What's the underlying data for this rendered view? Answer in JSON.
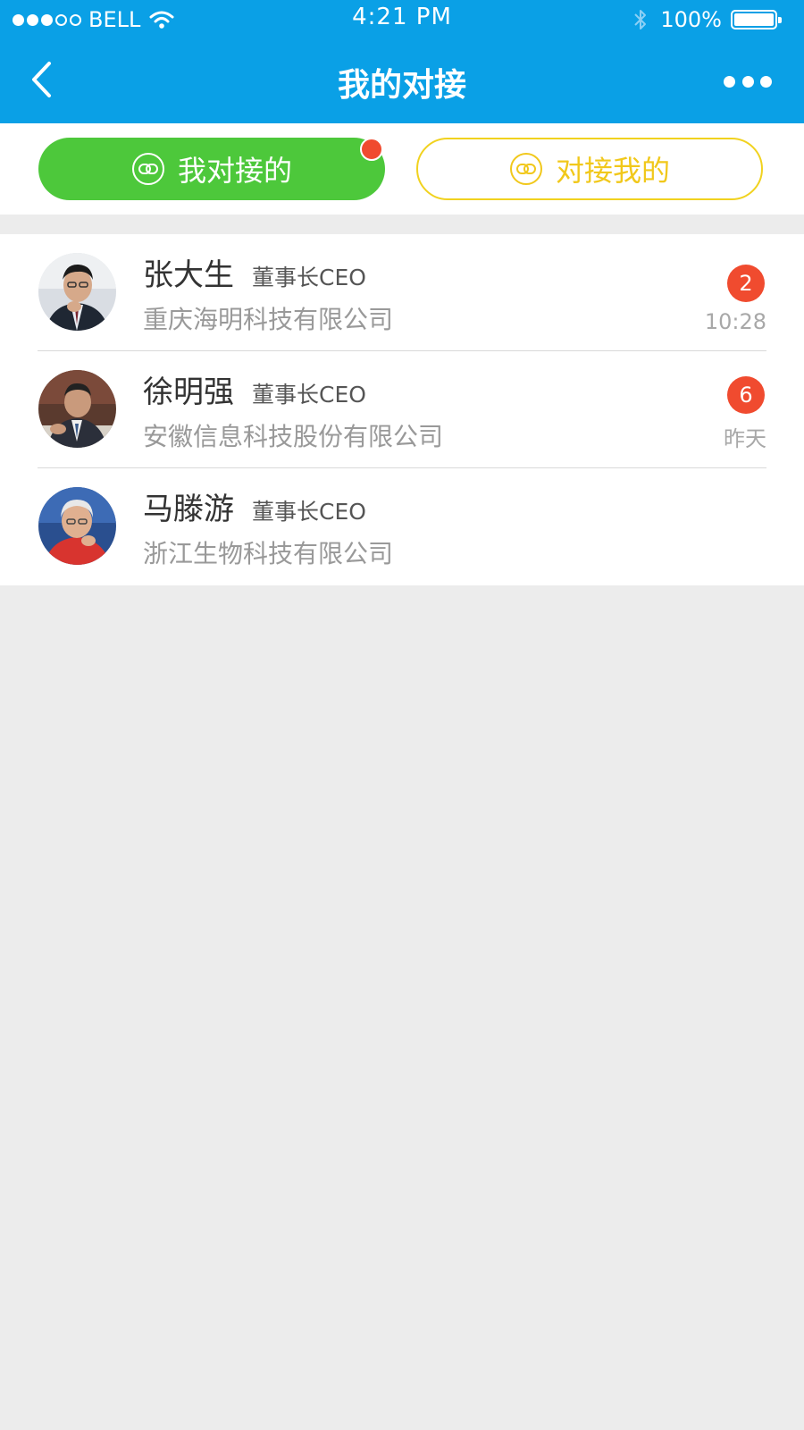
{
  "status_bar": {
    "carrier": "BELL",
    "time": "4:21 PM",
    "battery": "100%",
    "signal_bars_filled": 3,
    "signal_bars_total": 5
  },
  "nav": {
    "title": "我的对接",
    "back_icon": "chevron-left-icon",
    "more_icon": "more-horizontal-icon"
  },
  "tabs": [
    {
      "label": "我对接的",
      "active": true,
      "has_dot": true,
      "icon": "link-icon"
    },
    {
      "label": "对接我的",
      "active": false,
      "has_dot": false,
      "icon": "link-icon"
    }
  ],
  "contacts": [
    {
      "name": "张大生",
      "title": "董事长CEO",
      "company": "重庆海明科技有限公司",
      "unread": "2",
      "time": "10:28"
    },
    {
      "name": "徐明强",
      "title": "董事长CEO",
      "company": "安徽信息科技股份有限公司",
      "unread": "6",
      "time": "昨天"
    },
    {
      "name": "马滕游",
      "title": "董事长CEO",
      "company": "浙江生物科技有限公司",
      "unread": null,
      "time": null
    }
  ],
  "colors": {
    "header_bg": "#0aa0e6",
    "tab_active_bg": "#4dc83b",
    "tab_inactive_accent": "#f1c81b",
    "badge_red": "#f04b2f",
    "page_bg": "#ececec"
  }
}
